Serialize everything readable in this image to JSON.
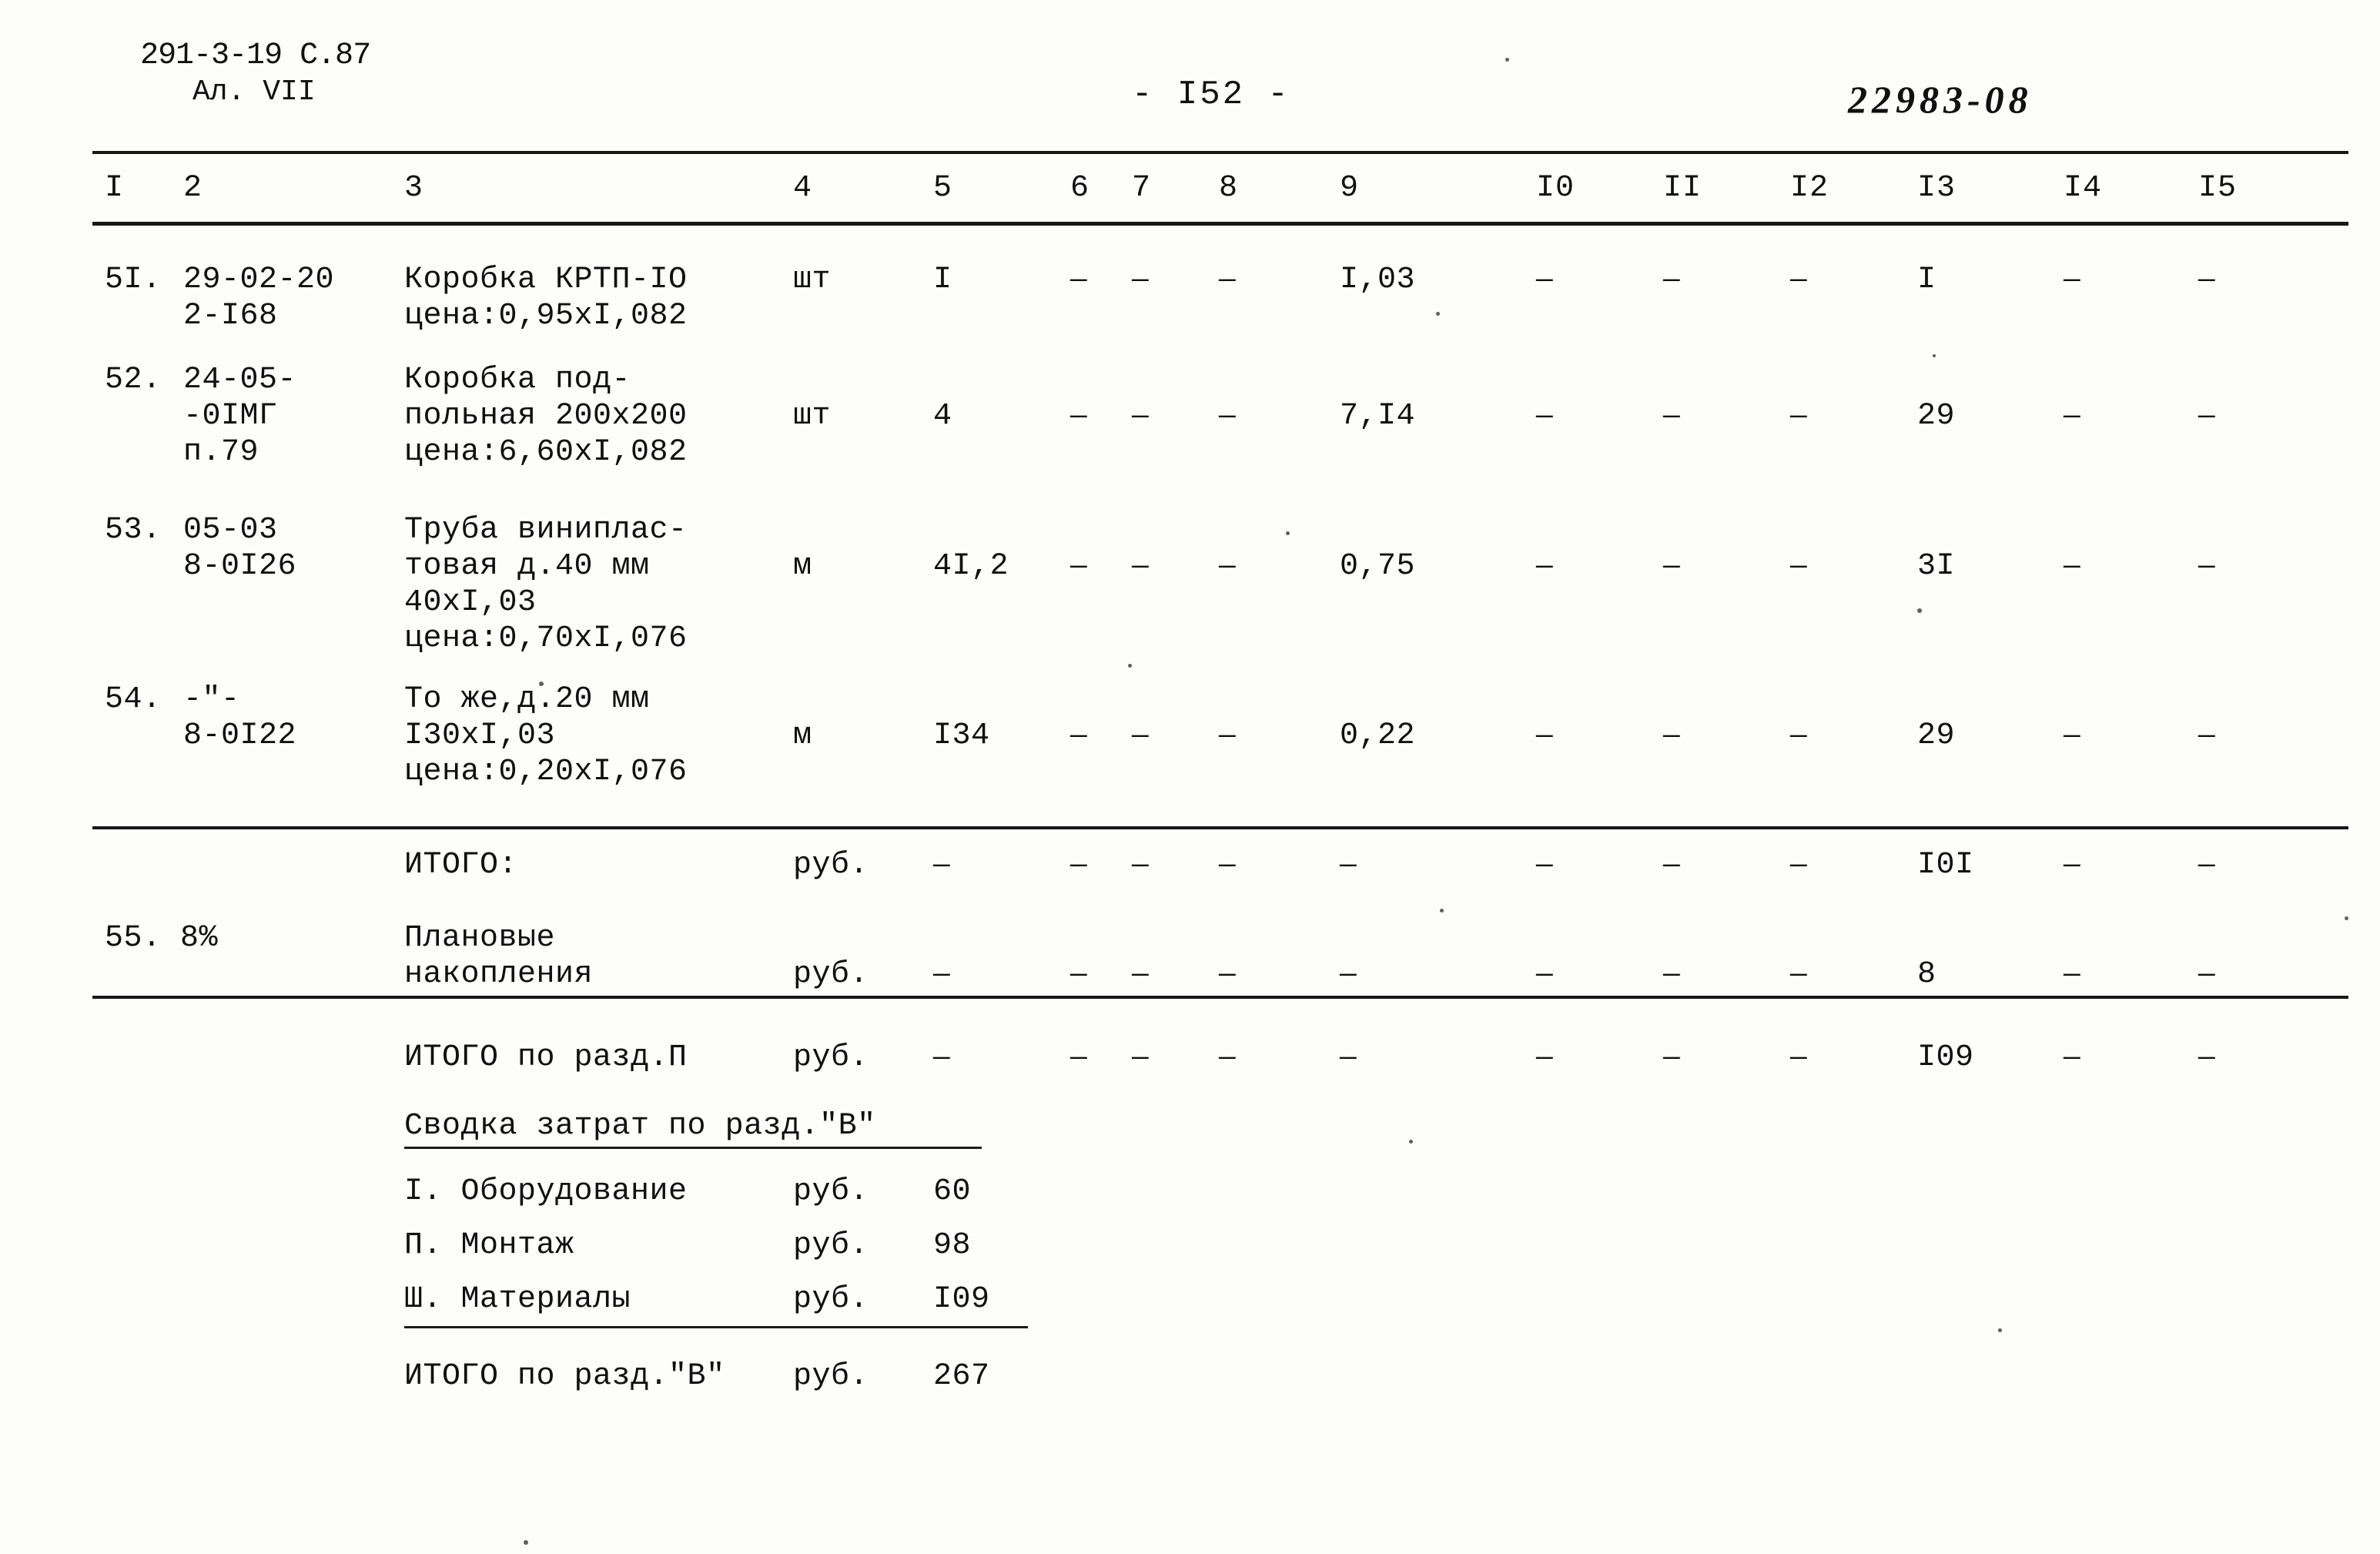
{
  "header": {
    "doc_code": "291-3-19 C.87",
    "album": "Ал. VII",
    "page_number": "- I52 -",
    "stamp": "22983-08"
  },
  "table": {
    "column_headers": [
      "I",
      "2",
      "3",
      "4",
      "5",
      "6",
      "7",
      "8",
      "9",
      "I0",
      "II",
      "I2",
      "I3",
      "I4",
      "I5"
    ],
    "dash": "—",
    "rows": [
      {
        "no": "5I.",
        "code_lines": [
          "29-02-20",
          "2-I68"
        ],
        "name_lines": [
          "Коробка КРТП-IO",
          "цена:0,95xI,082"
        ],
        "unit": "шт",
        "c5": "I",
        "c6": "—",
        "c7": "—",
        "c8": "—",
        "c9": "I,03",
        "c10": "—",
        "c11": "—",
        "c12": "—",
        "c13": "I",
        "c14": "—",
        "c15": "—"
      },
      {
        "no": "52.",
        "code_lines": [
          "24-05-",
          "-0IМГ",
          "п.79"
        ],
        "name_lines": [
          "Коробка под-",
          "польная 200x200",
          "цена:6,60xI,082"
        ],
        "unit": "шт",
        "c5": "4",
        "c6": "—",
        "c7": "—",
        "c8": "—",
        "c9": "7,I4",
        "c10": "—",
        "c11": "—",
        "c12": "—",
        "c13": "29",
        "c14": "—",
        "c15": "—"
      },
      {
        "no": "53.",
        "code_lines": [
          "05-03",
          "8-0I26"
        ],
        "name_lines": [
          "Труба виниплас-",
          "товая д.40 мм",
          "40xI,03",
          "цена:0,70xI,076"
        ],
        "unit": "м",
        "c5": "4I,2",
        "c6": "—",
        "c7": "—",
        "c8": "—",
        "c9": "0,75",
        "c10": "—",
        "c11": "—",
        "c12": "—",
        "c13": "3I",
        "c14": "—",
        "c15": "—"
      },
      {
        "no": "54.",
        "code_lines": [
          "-\"-",
          "8-0I22"
        ],
        "name_lines": [
          "То же,д.20 мм",
          "I30xI,03",
          "цена:0,20xI,076"
        ],
        "unit": "м",
        "c5": "I34",
        "c6": "—",
        "c7": "—",
        "c8": "—",
        "c9": "0,22",
        "c10": "—",
        "c11": "—",
        "c12": "—",
        "c13": "29",
        "c14": "—",
        "c15": "—"
      }
    ],
    "total_rows": [
      {
        "no": "",
        "label": "ИТОГО:",
        "unit": "руб.",
        "c5": "—",
        "c6": "—",
        "c7": "—",
        "c8": "—",
        "c9": "—",
        "c10": "—",
        "c11": "—",
        "c12": "—",
        "c13": "I0I",
        "c14": "—",
        "c15": "—"
      },
      {
        "no": "55. 8%",
        "label_lines": [
          "Плановые",
          "накопления"
        ],
        "unit": "руб.",
        "c5": "—",
        "c6": "—",
        "c7": "—",
        "c8": "—",
        "c9": "—",
        "c10": "—",
        "c11": "—",
        "c12": "—",
        "c13": "8",
        "c14": "—",
        "c15": "—"
      },
      {
        "no": "",
        "label": "ИТОГО по разд.П",
        "unit": "руб.",
        "c5": "—",
        "c6": "—",
        "c7": "—",
        "c8": "—",
        "c9": "—",
        "c10": "—",
        "c11": "—",
        "c12": "—",
        "c13": "I09",
        "c14": "—",
        "c15": "—"
      }
    ]
  },
  "summary": {
    "title": "Сводка затрат по разд.\"В\"",
    "items": [
      {
        "label": "I. Оборудование",
        "unit": "руб.",
        "value": "60"
      },
      {
        "label": "П. Монтаж",
        "unit": "руб.",
        "value": "98"
      },
      {
        "label": "Ш. Материалы",
        "unit": "руб.",
        "value": "I09"
      }
    ],
    "total": {
      "label": "ИТОГО по разд.\"В\"",
      "unit": "руб.",
      "value": "267"
    }
  }
}
